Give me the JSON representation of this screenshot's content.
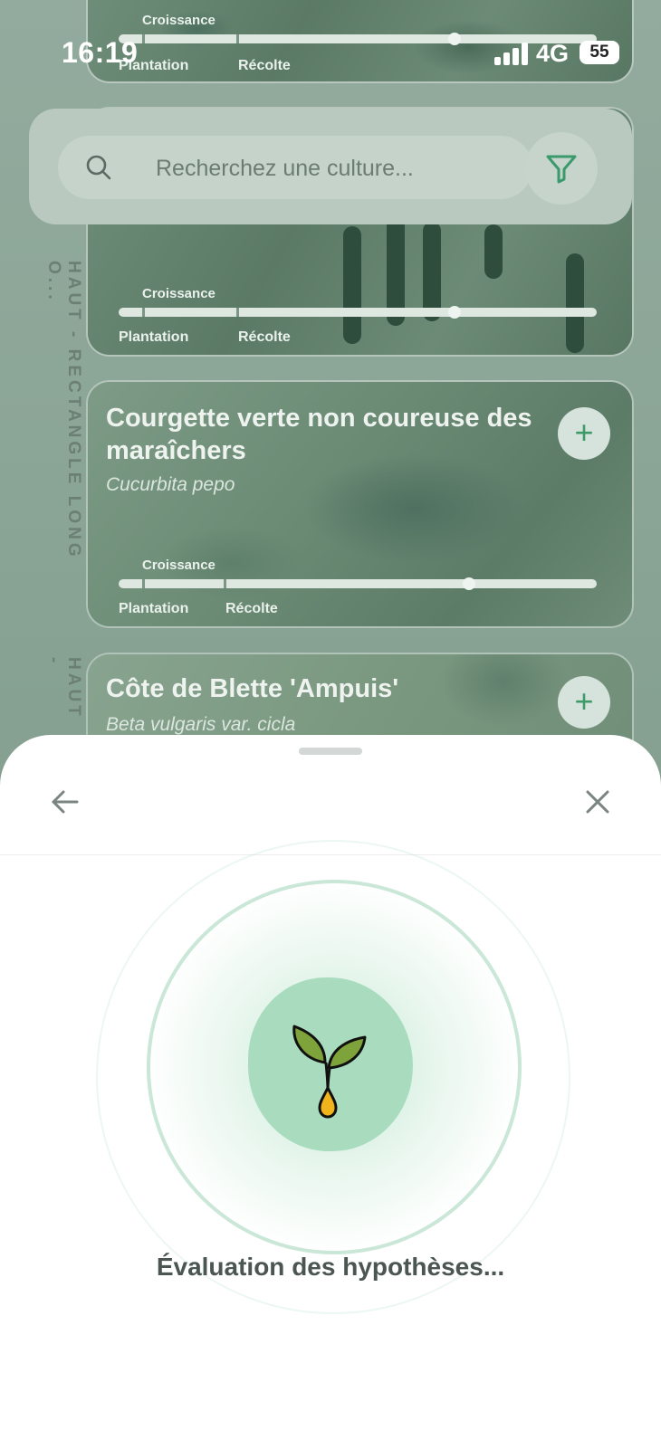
{
  "status_bar": {
    "time": "16:19",
    "network": "4G",
    "battery": "55"
  },
  "search": {
    "placeholder": "Recherchez une culture..."
  },
  "side_labels": [
    "HAUT - RECTANGLE LONG O...",
    "HAUT -"
  ],
  "cards": [
    {
      "progress": {
        "top_label": "Croissance",
        "left_label": "Plantation",
        "right_label": "Récolte"
      }
    },
    {
      "progress": {
        "top_label": "Croissance",
        "left_label": "Plantation",
        "right_label": "Récolte"
      }
    },
    {
      "title": "Courgette verte non coureuse des maraîchers",
      "latin": "Cucurbita pepo",
      "add_label": "+",
      "progress": {
        "top_label": "Croissance",
        "left_label": "Plantation",
        "right_label": "Récolte"
      }
    },
    {
      "title": "Côte de Blette 'Ampuis'",
      "latin": "Beta vulgaris var. cicla",
      "add_label": "+"
    }
  ],
  "sheet": {
    "loading_text": "Évaluation des hypothèses...",
    "icon": "sprout-icon"
  },
  "colors": {
    "accent_green": "#4fb07d",
    "sprout_leaf": "#7ea33a",
    "sprout_seed": "#f2b41c"
  }
}
